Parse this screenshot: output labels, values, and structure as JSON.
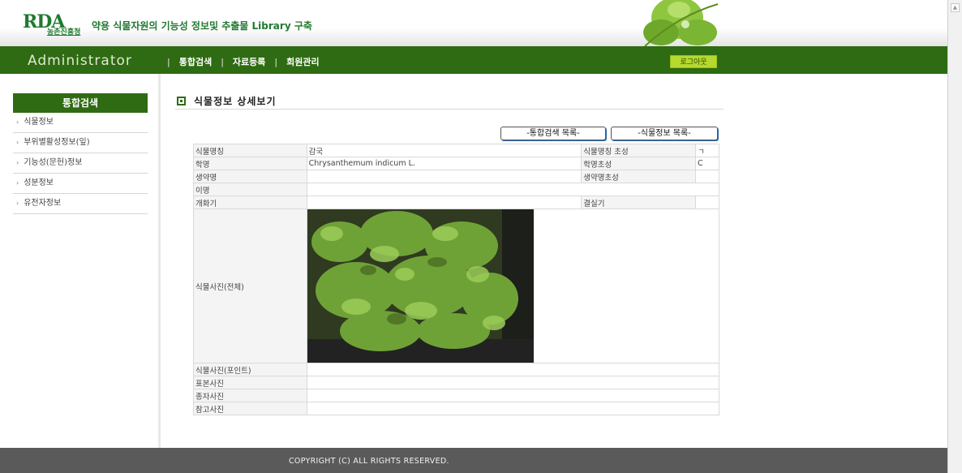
{
  "header": {
    "logo_text": "RDA",
    "logo_sub": "농촌진흥청",
    "title": "약용 식물자원의 기능성 정보및 추출물 Library 구축"
  },
  "nav": {
    "admin_label": "Administrator",
    "items": [
      "통합검색",
      "자료등록",
      "회원관리"
    ],
    "separator": "|",
    "logout_label": "로그아웃"
  },
  "sidebar": {
    "title": "통합검색",
    "items": [
      {
        "label": "식물정보"
      },
      {
        "label": "부위별활성정보(잎)"
      },
      {
        "label": "기능성(문헌)정보"
      },
      {
        "label": "성분정보"
      },
      {
        "label": "유전자정보"
      }
    ]
  },
  "main": {
    "heading": "식물정보 상세보기",
    "buttons": {
      "search_list": "-통합검색 목록-",
      "plant_list": "-식물정보 목록-"
    },
    "rows": {
      "name": {
        "label": "식물명칭",
        "value": "감국",
        "label2": "식물명칭 초성",
        "value2": "ㄱ"
      },
      "sci": {
        "label": "학명",
        "value": "Chrysanthemum indicum L.",
        "label2": "학명초성",
        "value2": "C"
      },
      "herb": {
        "label": "생약명",
        "value": "",
        "label2": "생약명초성",
        "value2": ""
      },
      "alias": {
        "label": "이명",
        "value": ""
      },
      "flower": {
        "label": "개화기",
        "value": "",
        "label2": "결실기",
        "value2": ""
      },
      "photo_full": {
        "label": "식물사진(전체)"
      },
      "photo_point": {
        "label": "식물사진(포인트)",
        "value": ""
      },
      "specimen": {
        "label": "표본사진",
        "value": ""
      },
      "seed": {
        "label": "종자사진",
        "value": ""
      },
      "ref": {
        "label": "참고사진",
        "value": ""
      }
    }
  },
  "footer": {
    "copyright": "COPYRIGHT (C) ALL RIGHTS RESERVED."
  },
  "colors": {
    "nav_green": "#2e6b12",
    "logout_lime": "#b6d92e",
    "footer_grey": "#5a5a5a"
  }
}
